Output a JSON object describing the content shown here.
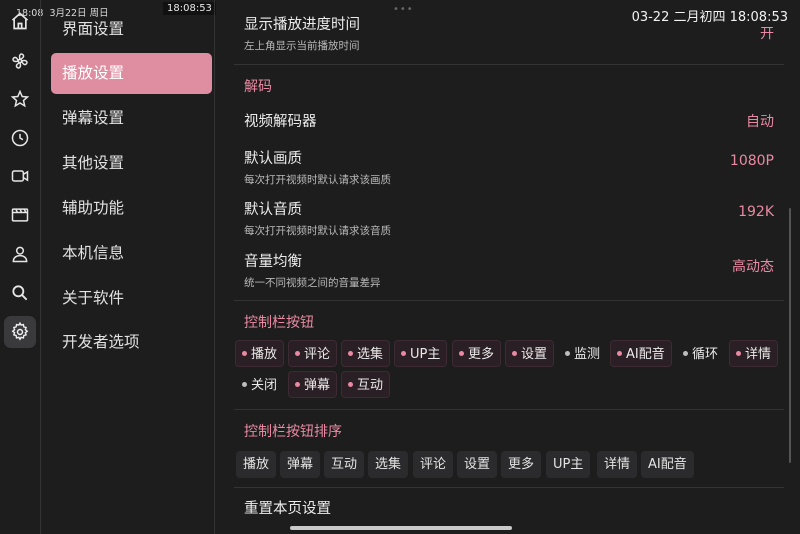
{
  "status": {
    "left_time": "18:08",
    "left_date": "3月22日 周日",
    "badge_time": "18:08:53",
    "right_datetime": "03-22 二月初四 18:08:53"
  },
  "rail": {
    "icons": [
      "home-icon",
      "fan-icon",
      "star-icon",
      "clock-icon",
      "video-camera-icon",
      "film-icon",
      "person-icon",
      "search-icon",
      "gear-icon"
    ],
    "active": "gear-icon"
  },
  "nav": {
    "items": [
      "界面设置",
      "播放设置",
      "弹幕设置",
      "其他设置",
      "辅助功能",
      "本机信息",
      "关于软件",
      "开发者选项"
    ],
    "active_index": 1
  },
  "settings": {
    "progress_time": {
      "title": "显示播放进度时间",
      "sub": "左上角显示当前播放时间",
      "value": "开"
    },
    "decode_header": "解码",
    "decoder": {
      "title": "视频解码器",
      "value": "自动"
    },
    "quality": {
      "title": "默认画质",
      "sub": "每次打开视频时默认请求该画质",
      "value": "1080P"
    },
    "audio_quality": {
      "title": "默认音质",
      "sub": "每次打开视频时默认请求该音质",
      "value": "192K"
    },
    "volume_balance": {
      "title": "音量均衡",
      "sub": "统一不同视频之间的音量差异",
      "value": "高动态"
    },
    "control_header": "控制栏按钮",
    "control_buttons": [
      {
        "label": "播放",
        "on": true
      },
      {
        "label": "评论",
        "on": true
      },
      {
        "label": "选集",
        "on": true
      },
      {
        "label": "UP主",
        "on": true
      },
      {
        "label": "更多",
        "on": true
      },
      {
        "label": "设置",
        "on": true
      },
      {
        "label": "监测",
        "on": false
      },
      {
        "label": "AI配音",
        "on": true
      },
      {
        "label": "循环",
        "on": false
      },
      {
        "label": "详情",
        "on": true
      },
      {
        "label": "关闭",
        "on": false
      },
      {
        "label": "弹幕",
        "on": true
      },
      {
        "label": "互动",
        "on": true
      }
    ],
    "order_header": "控制栏按钮排序",
    "order_buttons": [
      "播放",
      "弹幕",
      "互动",
      "选集",
      "评论",
      "设置",
      "更多",
      "UP主",
      "详情",
      "AI配音"
    ],
    "reset_label": "重置本页设置"
  },
  "colors": {
    "accent": "#e98aa2",
    "nav_active_bg": "#df8ea2",
    "background": "#1d1d1e"
  }
}
